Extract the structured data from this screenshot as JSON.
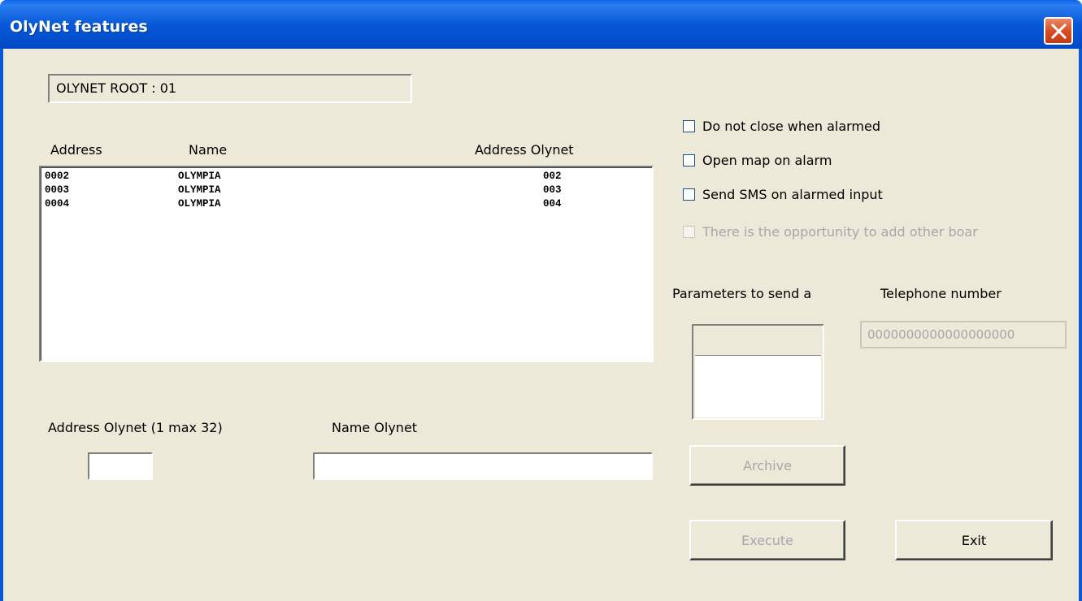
{
  "window": {
    "title": "OlyNet features"
  },
  "root_field": {
    "value": "OLYNET ROOT : 01"
  },
  "list": {
    "headers": {
      "address": "Address",
      "name": "Name",
      "address_olynet": "Address Olynet"
    },
    "rows": [
      {
        "address": "0002",
        "name": "OLYMPIA",
        "address_olynet": "002"
      },
      {
        "address": "0003",
        "name": "OLYMPIA",
        "address_olynet": "003"
      },
      {
        "address": "0004",
        "name": "OLYMPIA",
        "address_olynet": "004"
      }
    ]
  },
  "options": {
    "do_not_close": "Do not close when alarmed",
    "open_map": "Open map on alarm",
    "send_sms": "Send SMS on alarmed input",
    "add_other_boards": "There is the opportunity to add other boar"
  },
  "sms": {
    "parameters_label": "Parameters to send a",
    "telephone_label": "Telephone number",
    "telephone_value": "0000000000000000000"
  },
  "form": {
    "address_label": "Address Olynet (1 max 32)",
    "address_value": "",
    "name_label": "Name Olynet",
    "name_value": ""
  },
  "buttons": {
    "archive": "Archive",
    "execute": "Execute",
    "exit": "Exit"
  },
  "colors": {
    "titlebar": "#0858d8",
    "client_bg": "#ece9d8",
    "close": "#d74a22",
    "disabled_text": "#a7a6aa"
  }
}
